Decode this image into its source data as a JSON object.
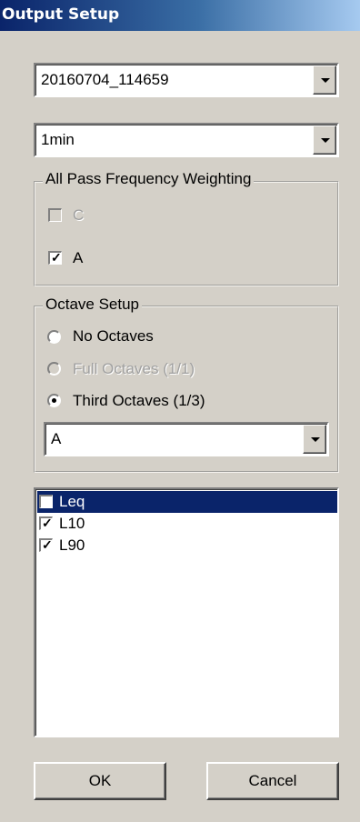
{
  "window": {
    "title": "Output Setup"
  },
  "file_select": {
    "value": "20160704_114659"
  },
  "interval_select": {
    "value": "1min"
  },
  "weighting_group": {
    "label": "All Pass Frequency Weighting",
    "options": [
      {
        "label": "C",
        "checked": false,
        "enabled": false
      },
      {
        "label": "A",
        "checked": true,
        "enabled": true
      }
    ]
  },
  "octave_group": {
    "label": "Octave Setup",
    "options": [
      {
        "label": "No Octaves",
        "selected": false,
        "enabled": true
      },
      {
        "label": "Full Octaves (1/1)",
        "selected": false,
        "enabled": false
      },
      {
        "label": "Third Octaves (1/3)",
        "selected": true,
        "enabled": true
      }
    ],
    "weighting_select": {
      "value": "A"
    }
  },
  "metrics_list": {
    "items": [
      {
        "label": "Leq",
        "checked": true,
        "selected": true
      },
      {
        "label": "L10",
        "checked": true,
        "selected": false
      },
      {
        "label": "L90",
        "checked": true,
        "selected": false
      }
    ]
  },
  "buttons": {
    "ok": "OK",
    "cancel": "Cancel"
  },
  "colors": {
    "title_bar": "#0a246a",
    "face": "#d4d0c8",
    "selection": "#0a246a"
  }
}
